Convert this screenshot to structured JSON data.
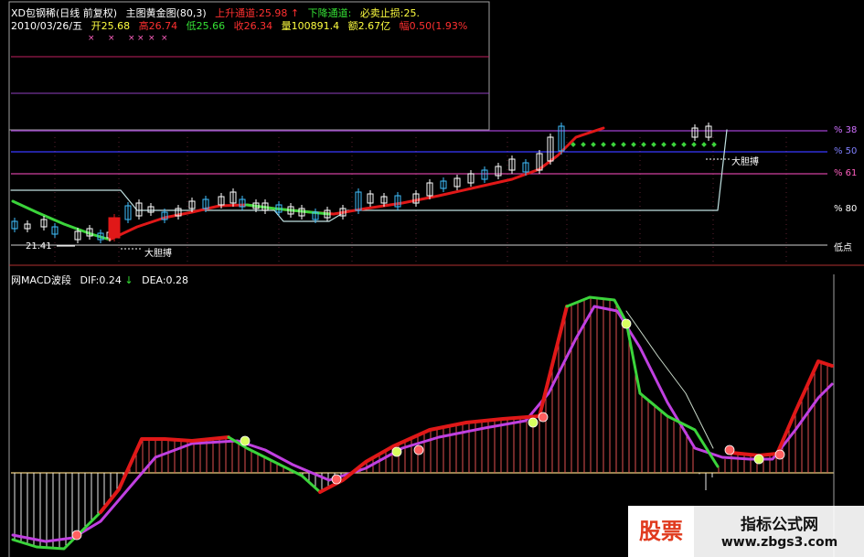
{
  "header": {
    "stock": "XD包钢稀(日线 前复权)",
    "indicator": "主图黄金图(80,3)",
    "up_channel": "上升通道:25.98",
    "up_arrow": "↑",
    "down_channel": "下降通道:",
    "stop_loss": "必卖止损:25.",
    "date": "2010/03/26/五",
    "open": "开25.68",
    "high": "高26.74",
    "low": "低25.66",
    "close": "收26.34",
    "volume": "量100891.4",
    "amount": "额2.67亿",
    "change": "幅0.50(1.93%"
  },
  "main_chart": {
    "level_labels": [
      "% 38",
      "% 50",
      "% 61",
      "% 80",
      "低点"
    ],
    "annotations": {
      "low_price": "21.41",
      "bold_buy_1": "大胆搏",
      "bold_buy_2": "大胆搏"
    },
    "colors": {
      "up_line": "#e01818",
      "down_line": "#3bd43b",
      "level_purple": "#a040d0",
      "level_blue": "#3838ff",
      "level_pink": "#d040a0",
      "grid": "#ff5c8a"
    }
  },
  "macd_panel": {
    "title": "网MACD波段",
    "dif": "DIF:0.24",
    "dif_arrow": "↓",
    "dea": "DEA:0.28"
  },
  "watermark": {
    "logo": "股票",
    "name": "指标公式网",
    "url": "www.zbgs3.com"
  }
}
